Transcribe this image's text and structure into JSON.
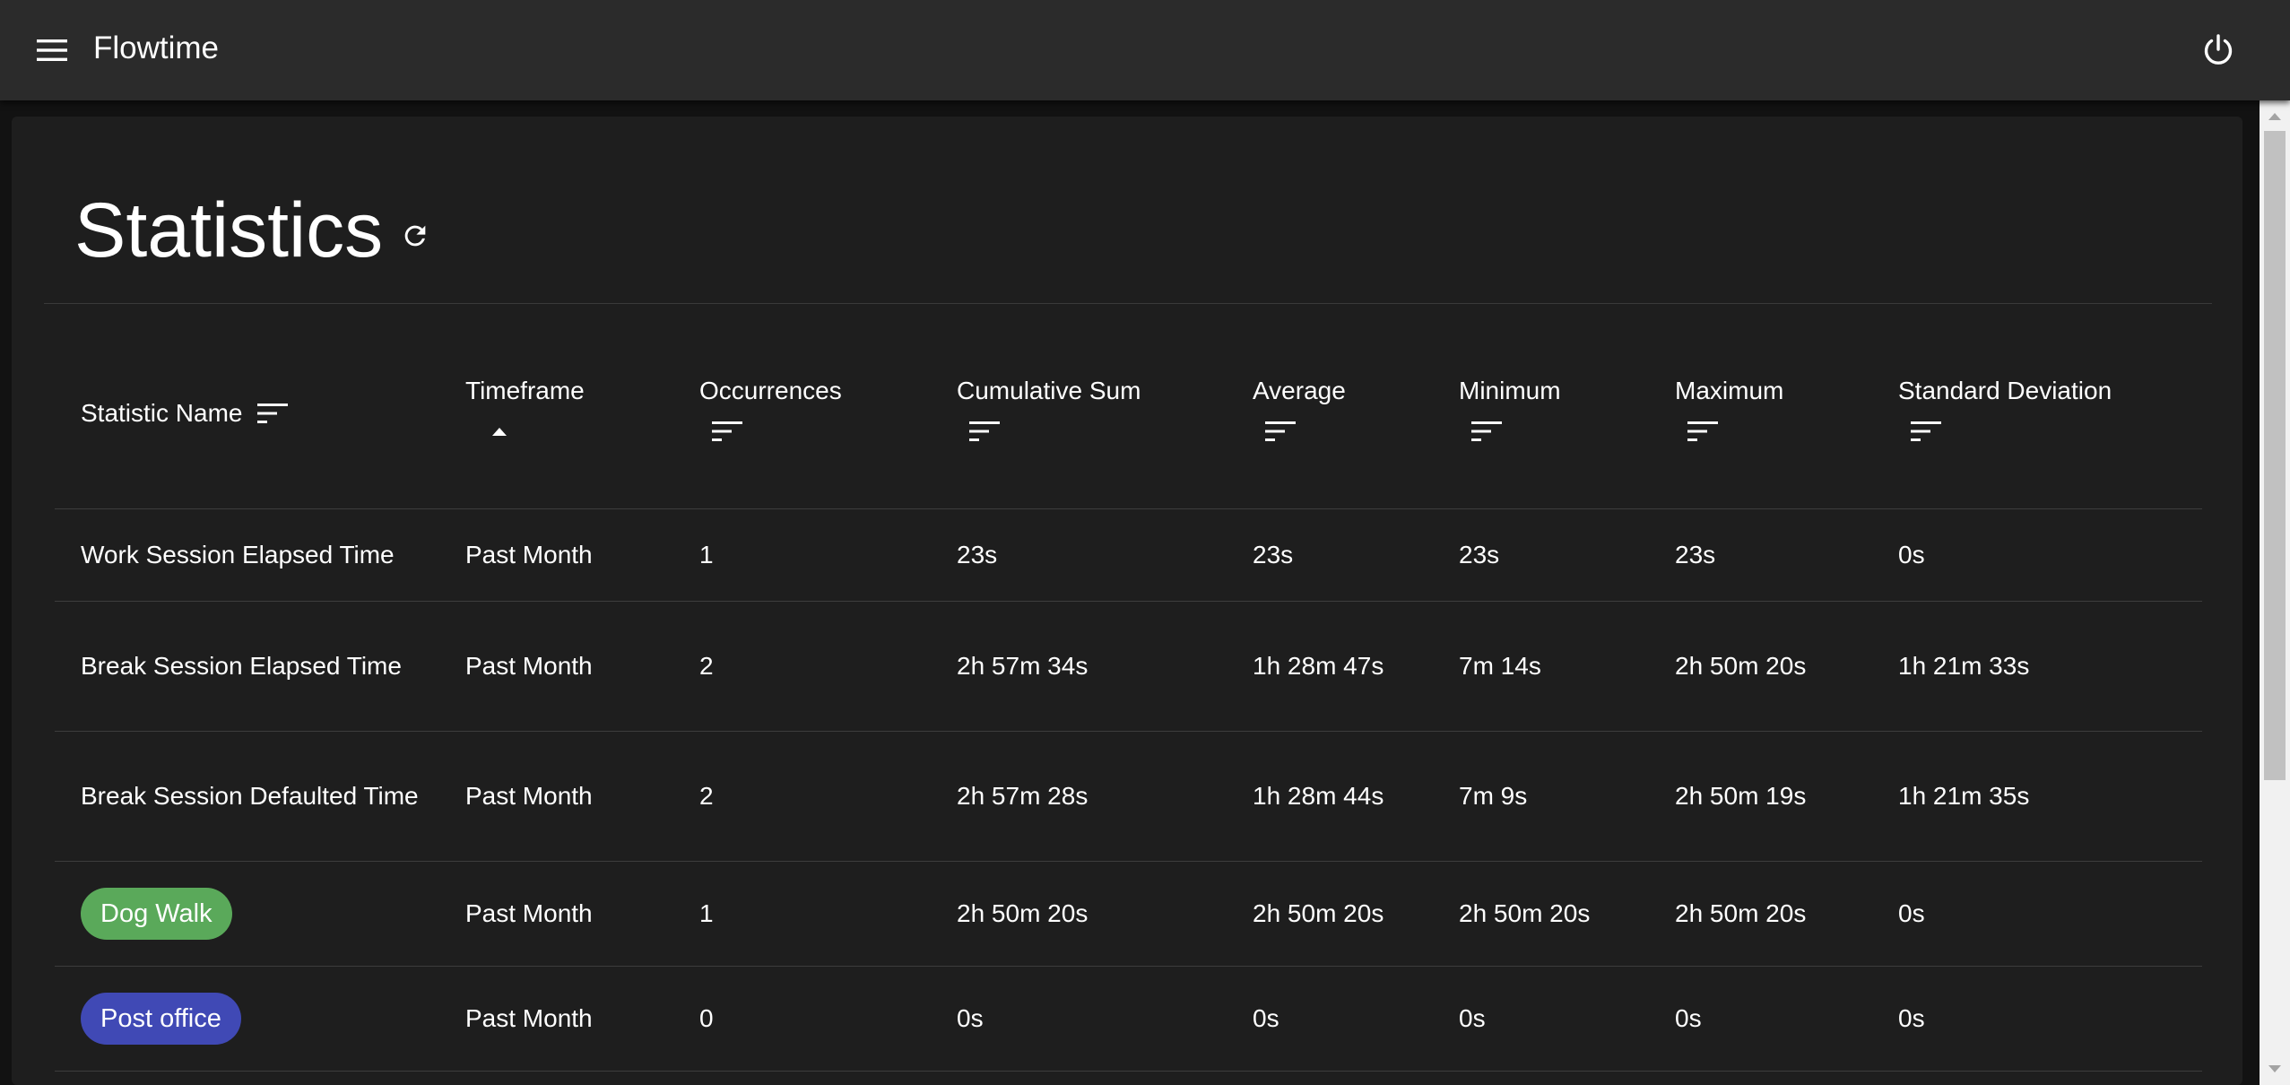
{
  "app": {
    "title": "Flowtime",
    "menu_icon": "hamburger-menu-icon",
    "power_icon": "power-icon"
  },
  "page": {
    "title": "Statistics",
    "refresh_icon": "refresh-icon"
  },
  "table": {
    "columns": [
      {
        "label": "Statistic Name",
        "sort_icon": "sort-lines-icon"
      },
      {
        "label": "Timeframe",
        "sort_icon": "sort-ascending-arrow-icon"
      },
      {
        "label": "Occurrences",
        "sort_icon": "sort-lines-icon"
      },
      {
        "label": "Cumulative Sum",
        "sort_icon": "sort-lines-icon"
      },
      {
        "label": "Average",
        "sort_icon": "sort-lines-icon"
      },
      {
        "label": "Minimum",
        "sort_icon": "sort-lines-icon"
      },
      {
        "label": "Maximum",
        "sort_icon": "sort-lines-icon"
      },
      {
        "label": "Standard Deviation",
        "sort_icon": "sort-lines-icon"
      }
    ],
    "rows": [
      {
        "name": "Work Session Elapsed Time",
        "timeframe": "Past Month",
        "occurrences": "1",
        "sum": "23s",
        "average": "23s",
        "minimum": "23s",
        "maximum": "23s",
        "stddev": "0s"
      },
      {
        "name": "Break Session Elapsed Time",
        "timeframe": "Past Month",
        "occurrences": "2",
        "sum": "2h 57m 34s",
        "average": "1h 28m 47s",
        "minimum": "7m 14s",
        "maximum": "2h 50m 20s",
        "stddev": "1h 21m 33s"
      },
      {
        "name": "Break Session Defaulted Time",
        "timeframe": "Past Month",
        "occurrences": "2",
        "sum": "2h 57m 28s",
        "average": "1h 28m 44s",
        "minimum": "7m 9s",
        "maximum": "2h 50m 19s",
        "stddev": "1h 21m 35s"
      },
      {
        "name": "Dog Walk",
        "chip_color": "#5aa95a",
        "timeframe": "Past Month",
        "occurrences": "1",
        "sum": "2h 50m 20s",
        "average": "2h 50m 20s",
        "minimum": "2h 50m 20s",
        "maximum": "2h 50m 20s",
        "stddev": "0s"
      },
      {
        "name": "Post office",
        "chip_color": "#4049b5",
        "timeframe": "Past Month",
        "occurrences": "0",
        "sum": "0s",
        "average": "0s",
        "minimum": "0s",
        "maximum": "0s",
        "stddev": "0s"
      }
    ]
  },
  "colors": {
    "appbar": "#2b2b2b",
    "background": "#121212",
    "card": "#1e1e1e",
    "text": "#ffffff",
    "divider": "#3d3d3d"
  }
}
